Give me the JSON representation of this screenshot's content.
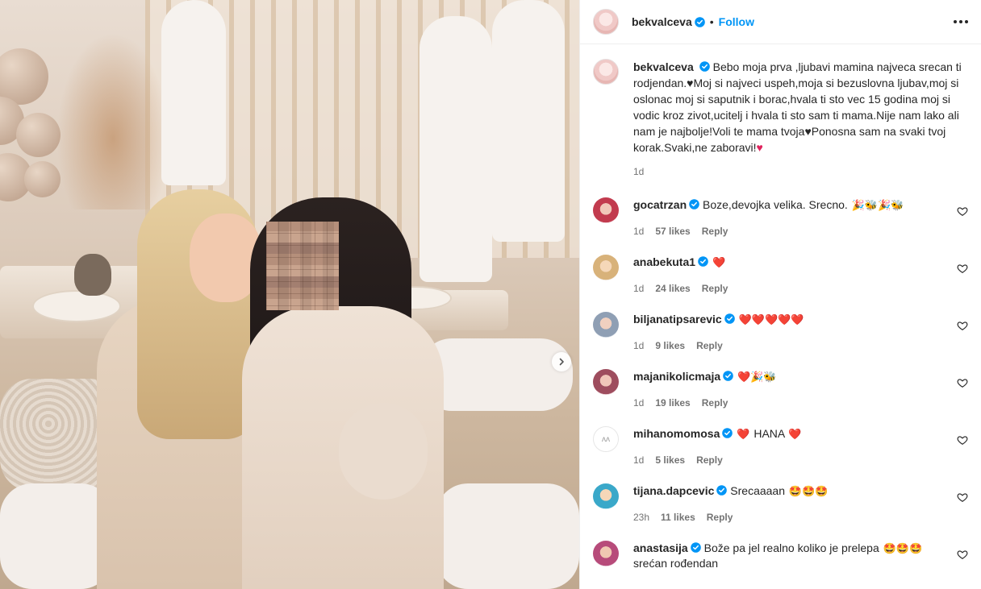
{
  "photo": {
    "next_button_label": "Next"
  },
  "header": {
    "username": "bekvalceva",
    "dot": "•",
    "follow_label": "Follow"
  },
  "caption": {
    "username": "bekvalceva",
    "text_1": "Bebo moja prva ,ljubavi mamina najveca srecan ti rodjendan.",
    "text_2": "Moj si najveci uspeh,moja si bezuslovna ljubav,moj si oslonac moj si saputnik i borac,hvala ti sto vec 15 godina moj si vodic kroz zivot,ucitelj i hvala ti sto sam ti mama.Nije nam lako ali nam je najbolje!Voli te mama tvoja",
    "text_3": "Ponosna sam na svaki tvoj korak.Svaki,ne zaboravi!",
    "time": "1d"
  },
  "comments": [
    {
      "username": "gocatrzan",
      "text": "Boze,devojka velika. Srecno.",
      "emoji": "🎉🐝🎉🐝",
      "time": "1d",
      "likes": "57 likes",
      "reply": "Reply"
    },
    {
      "username": "anabekuta1",
      "text": "",
      "emoji": "❤️",
      "time": "1d",
      "likes": "24 likes",
      "reply": "Reply"
    },
    {
      "username": "biljanatipsarevic",
      "text": "",
      "emoji": "❤️❤️❤️❤️❤️",
      "time": "1d",
      "likes": "9 likes",
      "reply": "Reply"
    },
    {
      "username": "majanikolicmaja",
      "text": "",
      "emoji": "❤️🎉🐝",
      "time": "1d",
      "likes": "19 likes",
      "reply": "Reply"
    },
    {
      "username": "mihanomomosa",
      "text": "HANA",
      "emoji_before": "❤️",
      "emoji": "❤️",
      "time": "1d",
      "likes": "5 likes",
      "reply": "Reply"
    },
    {
      "username": "tijana.dapcevic",
      "text": "Srecaaaan",
      "emoji": "🤩🤩🤩",
      "time": "23h",
      "likes": "11 likes",
      "reply": "Reply"
    },
    {
      "username": "anastasija",
      "text": "Bože pa jel realno koliko je prelepa",
      "emoji": "🤩🤩🤩",
      "text_2": "srećan rođendan"
    }
  ],
  "colors": {
    "link_blue": "#0095f6",
    "verified_blue": "#0095f6",
    "meta_gray": "#737373"
  }
}
